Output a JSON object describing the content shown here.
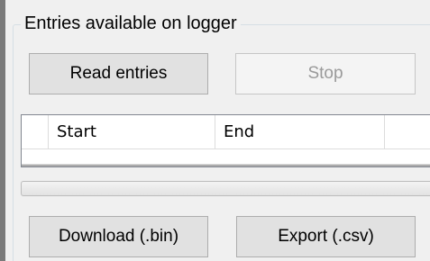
{
  "group": {
    "title": "Entries available on logger"
  },
  "buttons": {
    "read_entries": "Read entries",
    "stop": "Stop",
    "download_bin": "Download (.bin)",
    "export_csv": "Export (.csv)"
  },
  "table": {
    "columns": [
      "",
      "Start",
      "End",
      ""
    ],
    "rows": []
  },
  "progress": {
    "value_percent": 0
  }
}
